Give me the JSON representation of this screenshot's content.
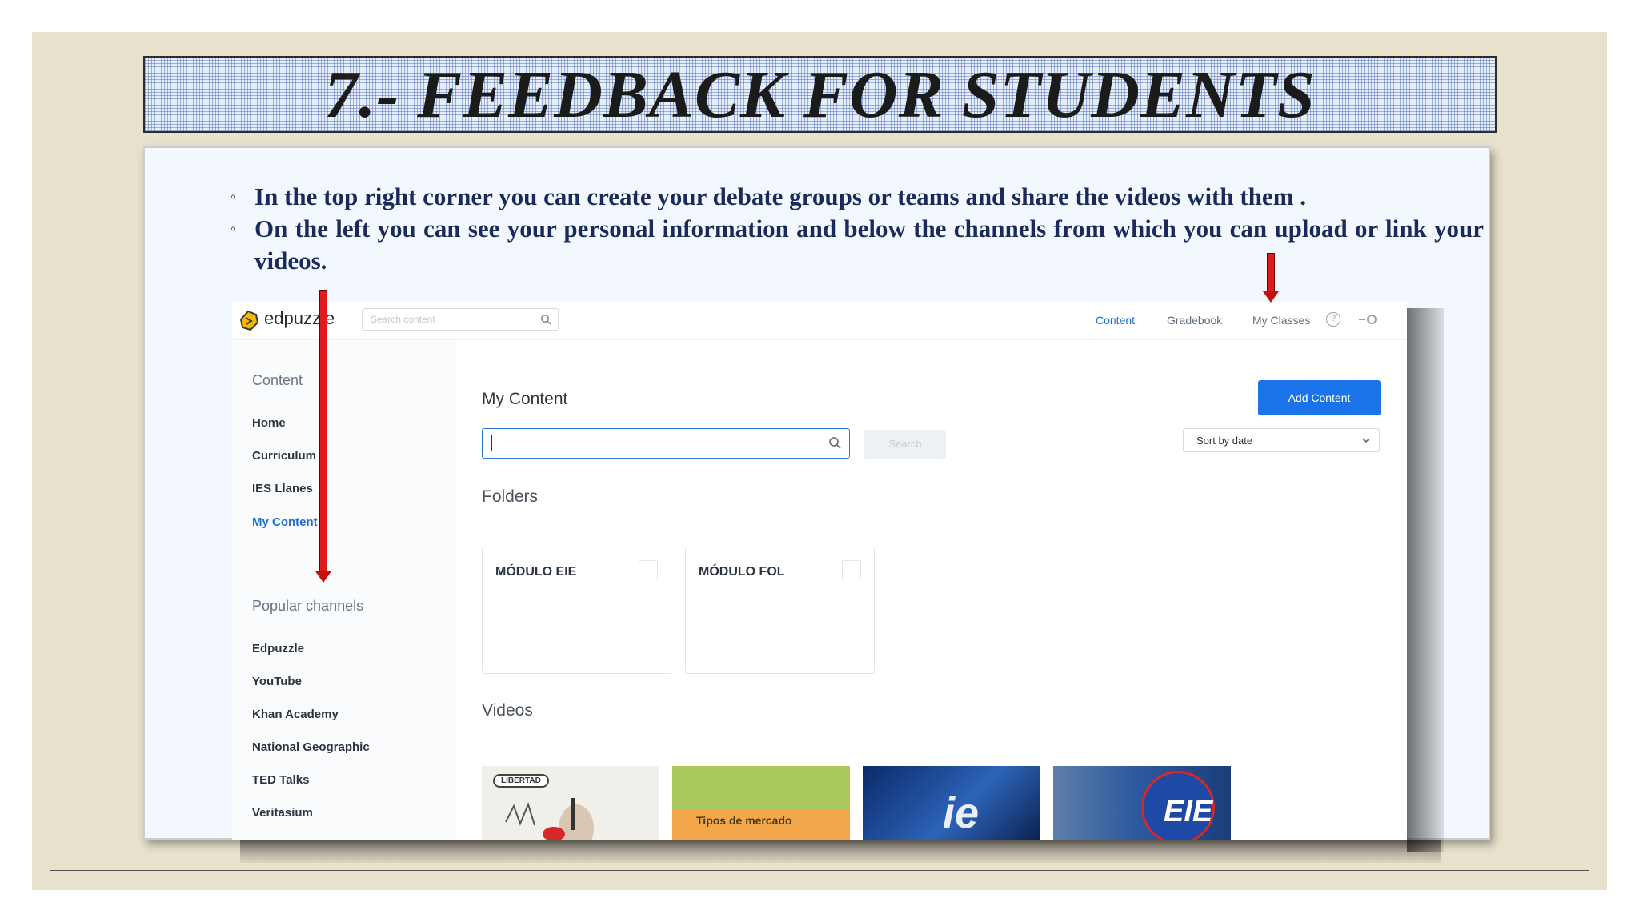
{
  "slide": {
    "title": "7.- FEEDBACK FOR STUDENTS",
    "bullets": [
      "In the top right corner you can create your debate groups or teams and share the videos with them .",
      "On the left you can see your personal information and below the channels from which you can upload or link your videos."
    ]
  },
  "edpuzzle": {
    "brand": "edpuzzle",
    "search_placeholder": "Search content",
    "nav": {
      "content": "Content",
      "gradebook": "Gradebook",
      "my_classes": "My Classes",
      "help": "?"
    },
    "sidebar": {
      "content_heading": "Content",
      "content_items": [
        "Home",
        "Curriculum",
        "IES Llanes",
        "My Content"
      ],
      "channels_heading": "Popular channels",
      "channels": [
        "Edpuzzle",
        "YouTube",
        "Khan Academy",
        "National Geographic",
        "TED Talks",
        "Veritasium"
      ]
    },
    "main": {
      "title": "My Content",
      "add_button": "Add Content",
      "search_button": "Search",
      "sort_label": "Sort by date",
      "folders_heading": "Folders",
      "folders": [
        "MÓDULO EIE",
        "MÓDULO FOL"
      ],
      "videos_heading": "Videos",
      "video_thumbs": [
        {
          "caption": "LIBERTAD"
        },
        {
          "caption": "Tipos de mercado"
        },
        {
          "caption": "ie"
        },
        {
          "caption": "EIE"
        }
      ]
    }
  },
  "colors": {
    "accent": "#1a73e8",
    "arrow": "#e11b1b",
    "bullet_text": "#1a2a5c",
    "frame": "#e8e1cb"
  }
}
